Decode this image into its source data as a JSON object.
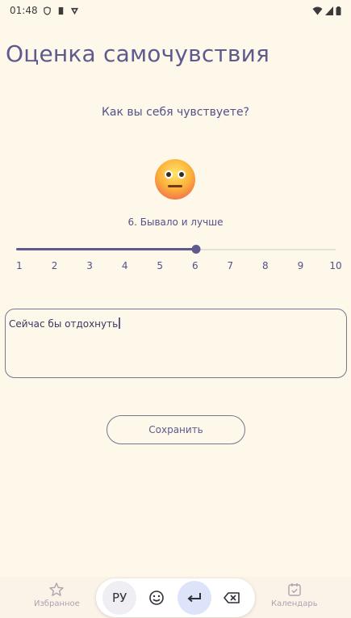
{
  "status_bar": {
    "time": "01:48"
  },
  "header": {
    "title": "Оценка самочувствия"
  },
  "question": "Как вы себя чувствуете?",
  "mood": {
    "emoji": "neutral-face",
    "label": "6. Бывало и лучше",
    "value": 6,
    "min": 1,
    "max": 10
  },
  "slider": {
    "ticks": [
      "1",
      "2",
      "3",
      "4",
      "5",
      "6",
      "7",
      "8",
      "9",
      "10"
    ]
  },
  "note": {
    "value": "Сейчас бы отдохнуть"
  },
  "save_button": {
    "label": "Сохранить"
  },
  "bottom_nav": {
    "favorites_label": "Избранное",
    "calendar_label": "Календарь"
  },
  "keyboard": {
    "language_label": "РУ"
  },
  "colors": {
    "background": "#fdf8ea",
    "accent": "#5e5a8e"
  }
}
